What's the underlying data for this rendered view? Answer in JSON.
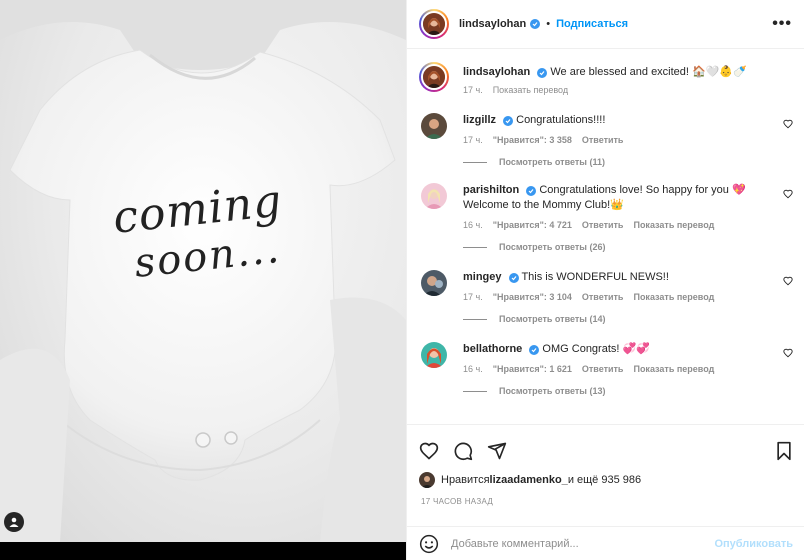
{
  "header": {
    "username": "lindsaylohan",
    "separator": "•",
    "follow_label": "Подписаться",
    "more_label": "•••"
  },
  "photo": {
    "text_line1": "coming",
    "text_line2": "soon..."
  },
  "caption": {
    "username": "lindsaylohan",
    "text": "We are blessed and excited! 🏠🤍👶🍼",
    "time": "17 ч.",
    "translate": "Показать перевод"
  },
  "comments": [
    {
      "username": "lizgillz",
      "text": "Congratulations!!!!",
      "time": "17 ч.",
      "likes": "\"Нравится\": 3 358",
      "reply": "Ответить",
      "translate": "",
      "replies": "Посмотреть ответы (11)"
    },
    {
      "username": "parishilton",
      "text": "Congratulations love! So happy for you 💖 Welcome to the Mommy Club!👑",
      "time": "16 ч.",
      "likes": "\"Нравится\": 4 721",
      "reply": "Ответить",
      "translate": "Показать перевод",
      "replies": "Посмотреть ответы (26)"
    },
    {
      "username": "mingey",
      "text": "This is WONDERFUL NEWS!!",
      "time": "17 ч.",
      "likes": "\"Нравится\": 3 104",
      "reply": "Ответить",
      "translate": "Показать перевод",
      "replies": "Посмотреть ответы (14)"
    },
    {
      "username": "bellathorne",
      "text": "OMG Congrats! 💞💞",
      "time": "16 ч.",
      "likes": "\"Нравится\": 1 621",
      "reply": "Ответить",
      "translate": "Показать перевод",
      "replies": "Посмотреть ответы (13)"
    }
  ],
  "likes": {
    "prefix": "Нравится ",
    "user": "lizaadamenko_",
    "suffix": " и ещё 935 986"
  },
  "timestamp": "17 ЧАСОВ НАЗАД",
  "add_comment": {
    "placeholder": "Добавьте комментарий...",
    "post_label": "Опубликовать"
  },
  "colors": {
    "accent": "#0095f6",
    "verified": "#3897f0",
    "muted": "#8e8e8e"
  }
}
